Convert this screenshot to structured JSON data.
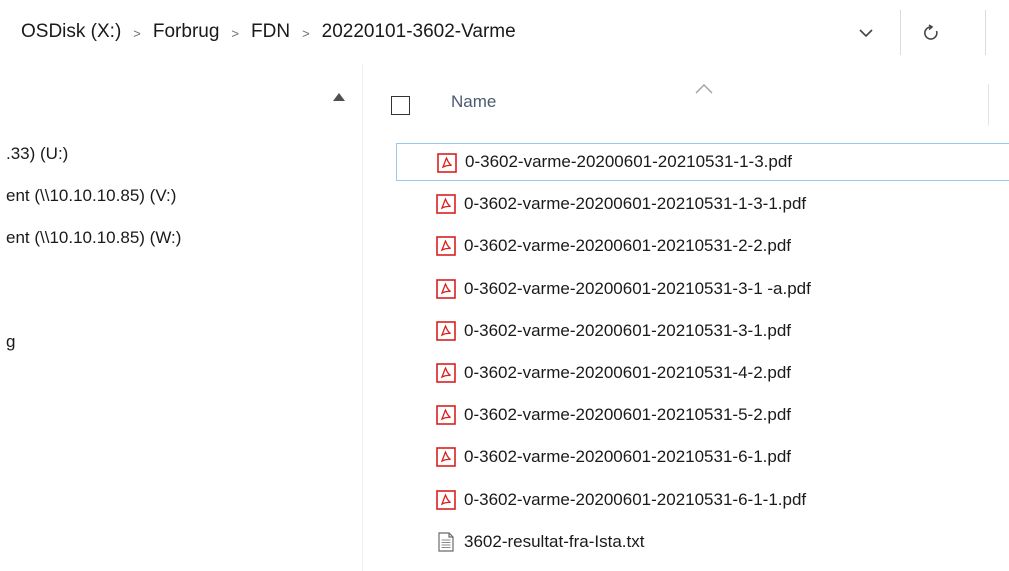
{
  "address_bar": {
    "breadcrumbs": [
      "OSDisk (X:)",
      "Forbrug",
      "FDN",
      "20220101-3602-Varme"
    ],
    "separator": ">"
  },
  "nav_pane": {
    "items": [
      ".33) (U:)",
      "ent (\\\\10.10.10.85) (V:)",
      "ent (\\\\10.10.10.85) (W:)",
      "g"
    ]
  },
  "file_list": {
    "column_header": "Name",
    "files": [
      {
        "name": "0-3602-varme-20200601-20210531-1-3.pdf",
        "icon": "pdf-icon"
      },
      {
        "name": "0-3602-varme-20200601-20210531-1-3-1.pdf",
        "icon": "pdf-icon"
      },
      {
        "name": "0-3602-varme-20200601-20210531-2-2.pdf",
        "icon": "pdf-icon"
      },
      {
        "name": "0-3602-varme-20200601-20210531-3-1 -a.pdf",
        "icon": "pdf-icon"
      },
      {
        "name": "0-3602-varme-20200601-20210531-3-1.pdf",
        "icon": "pdf-icon"
      },
      {
        "name": "0-3602-varme-20200601-20210531-4-2.pdf",
        "icon": "pdf-icon"
      },
      {
        "name": "0-3602-varme-20200601-20210531-5-2.pdf",
        "icon": "pdf-icon"
      },
      {
        "name": "0-3602-varme-20200601-20210531-6-1.pdf",
        "icon": "pdf-icon"
      },
      {
        "name": "0-3602-varme-20200601-20210531-6-1-1.pdf",
        "icon": "pdf-icon"
      },
      {
        "name": "3602-resultat-fra-Ista.txt",
        "icon": "text-file-icon"
      }
    ]
  },
  "colors": {
    "pdf_red": "#d9211f",
    "focus_border": "#99c9ef",
    "header_text": "#4a5a70"
  }
}
